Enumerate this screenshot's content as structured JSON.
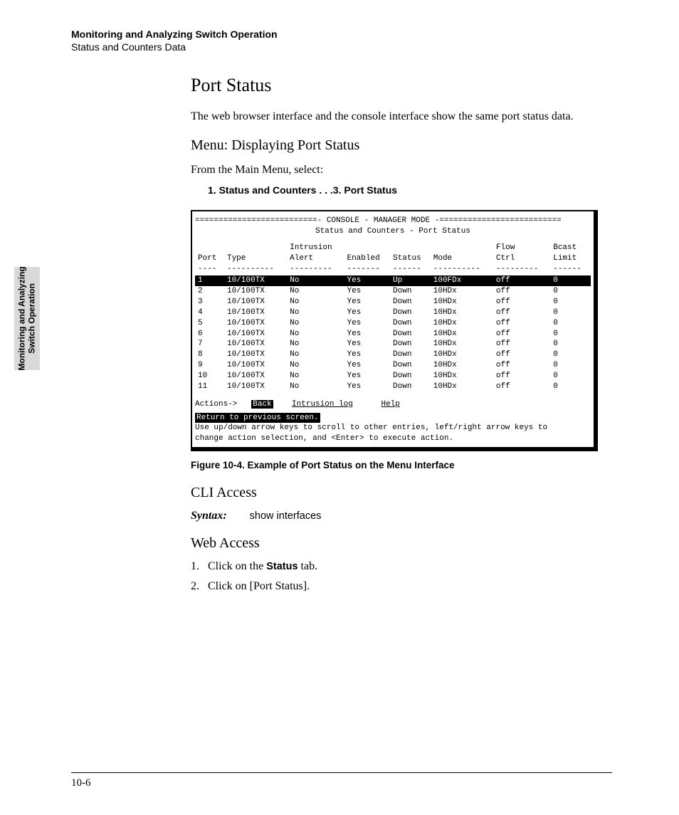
{
  "header": {
    "chapter_title": "Monitoring and Analyzing Switch Operation",
    "section_title": "Status and Counters Data"
  },
  "side_tab": {
    "line1": "Monitoring and Analyzing",
    "line2": "Switch Operation"
  },
  "content": {
    "h1": "Port Status",
    "intro": "The web browser interface and the console interface show the same port status data.",
    "menu_h2": "Menu: Displaying Port Status",
    "menu_intro": "From the Main Menu, select:",
    "menu_path": "1. Status and Counters . . .3. Port Status",
    "console": {
      "banner": "==========================- CONSOLE - MANAGER MODE -==========================",
      "subtitle": "Status and Counters - Port Status",
      "columns": [
        "Port",
        "Type",
        "Intrusion Alert",
        "Enabled",
        "Status",
        "Mode",
        "Flow Ctrl",
        "Bcast Limit"
      ],
      "dashes": [
        "----",
        "----------",
        "---------",
        "-------",
        "------",
        "----------",
        "---------",
        "------"
      ],
      "rows": [
        {
          "port": "1",
          "type": "10/100TX",
          "alert": "No",
          "enabled": "Yes",
          "status": "Up",
          "mode": "100FDx",
          "flow": "off",
          "bcast": "0",
          "selected": true
        },
        {
          "port": "2",
          "type": "10/100TX",
          "alert": "No",
          "enabled": "Yes",
          "status": "Down",
          "mode": "10HDx",
          "flow": "off",
          "bcast": "0"
        },
        {
          "port": "3",
          "type": "10/100TX",
          "alert": "No",
          "enabled": "Yes",
          "status": "Down",
          "mode": "10HDx",
          "flow": "off",
          "bcast": "0"
        },
        {
          "port": "4",
          "type": "10/100TX",
          "alert": "No",
          "enabled": "Yes",
          "status": "Down",
          "mode": "10HDx",
          "flow": "off",
          "bcast": "0"
        },
        {
          "port": "5",
          "type": "10/100TX",
          "alert": "No",
          "enabled": "Yes",
          "status": "Down",
          "mode": "10HDx",
          "flow": "off",
          "bcast": "0"
        },
        {
          "port": "6",
          "type": "10/100TX",
          "alert": "No",
          "enabled": "Yes",
          "status": "Down",
          "mode": "10HDx",
          "flow": "off",
          "bcast": "0"
        },
        {
          "port": "7",
          "type": "10/100TX",
          "alert": "No",
          "enabled": "Yes",
          "status": "Down",
          "mode": "10HDx",
          "flow": "off",
          "bcast": "0"
        },
        {
          "port": "8",
          "type": "10/100TX",
          "alert": "No",
          "enabled": "Yes",
          "status": "Down",
          "mode": "10HDx",
          "flow": "off",
          "bcast": "0"
        },
        {
          "port": "9",
          "type": "10/100TX",
          "alert": "No",
          "enabled": "Yes",
          "status": "Down",
          "mode": "10HDx",
          "flow": "off",
          "bcast": "0"
        },
        {
          "port": "10",
          "type": "10/100TX",
          "alert": "No",
          "enabled": "Yes",
          "status": "Down",
          "mode": "10HDx",
          "flow": "off",
          "bcast": "0"
        },
        {
          "port": "11",
          "type": "10/100TX",
          "alert": "No",
          "enabled": "Yes",
          "status": "Down",
          "mode": "10HDx",
          "flow": "off",
          "bcast": "0"
        }
      ],
      "actions_label": "Actions->",
      "actions": [
        "Back",
        "Intrusion log",
        "Help"
      ],
      "status_line": "Return to previous screen.",
      "help1": "Use up/down arrow keys to scroll to other entries, left/right arrow keys to",
      "help2": "change action selection, and <Enter> to execute action."
    },
    "figure_caption": "Figure 10-4.  Example of Port Status on the Menu Interface",
    "cli_h2": "CLI Access",
    "syntax_label": "Syntax:",
    "syntax_cmd": "show interfaces",
    "web_h2": "Web Access",
    "steps": [
      {
        "num": "1.",
        "pre": "Click on the ",
        "bold": "Status",
        "post": " tab."
      },
      {
        "num": "2.",
        "pre": "Click on [Port Status].",
        "bold": "",
        "post": ""
      }
    ]
  },
  "footer": {
    "page": "10-6"
  }
}
